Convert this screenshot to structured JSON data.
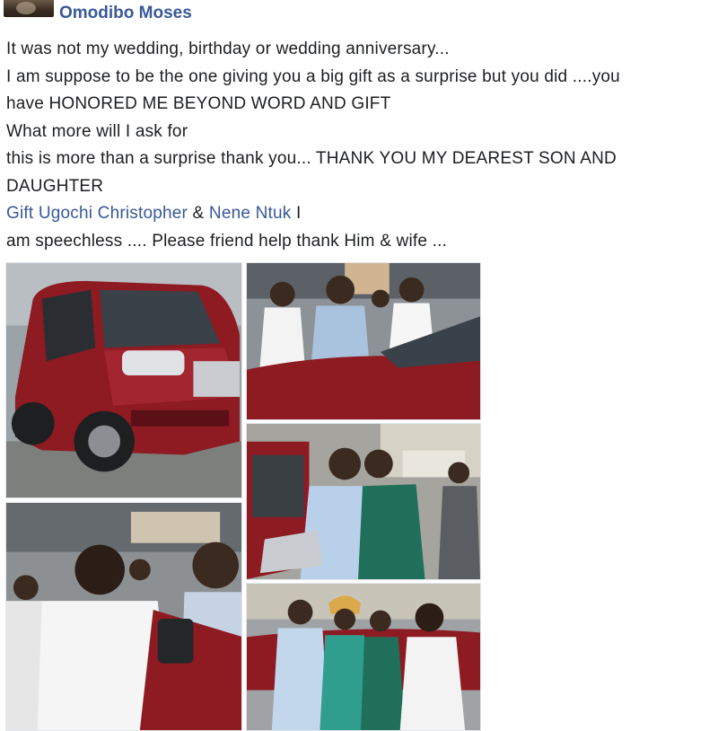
{
  "post": {
    "author": "Omodibo Moses",
    "lines": [
      "It was not my wedding, birthday or wedding anniversary...",
      "I am suppose to be the one giving you a big gift as  a surprise but you did ....you",
      "have HONORED ME BEYOND WORD AND GIFT",
      "What more will I ask for",
      "this is more than a surprise thank you...  THANK YOU MY DEAREST SON AND",
      "DAUGHTER"
    ],
    "mention_1": "Gift Ugochi Christopher",
    "mention_sep": " & ",
    "mention_2": "Nene Ntuk",
    "mention_tail": " I",
    "last_line": "am speechless ....  Please friend help thank Him & wife ..."
  },
  "colors": {
    "link": "#385898",
    "text": "#1c1e21",
    "car_red": "#8e1a22"
  },
  "gallery": {
    "photos": [
      "red-suv-photo",
      "couple-at-car-photo",
      "two-men-embrace-photo",
      "woman-at-car-door-photo",
      "family-group-photo"
    ]
  }
}
